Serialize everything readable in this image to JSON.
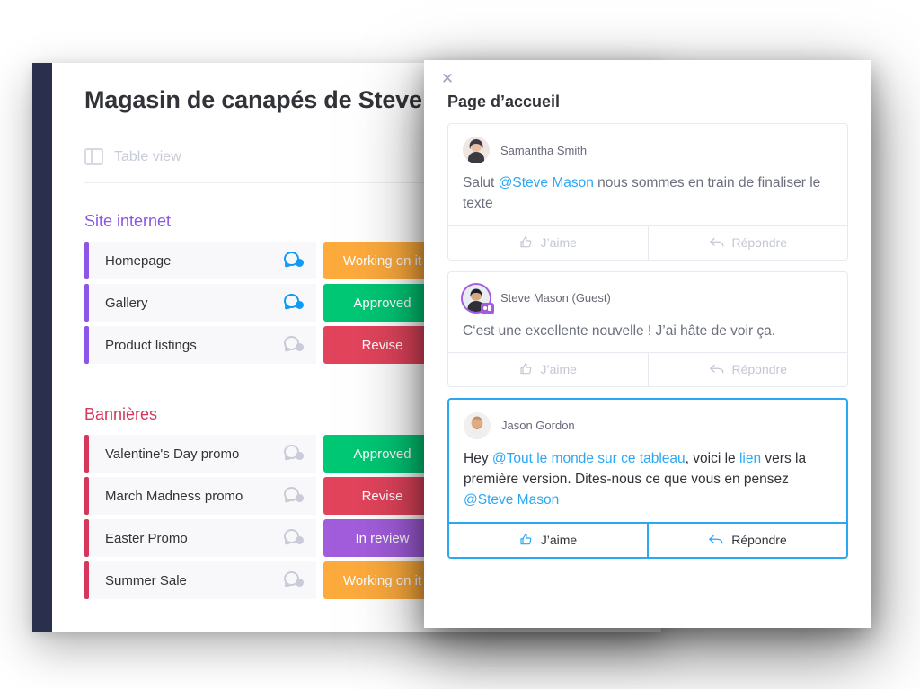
{
  "board": {
    "title": "Magasin de canapés de Steve",
    "view_label": "Table view",
    "view_icon": "table-view-icon",
    "groups": [
      {
        "name": "Site internet",
        "color": "#8c54e8",
        "items": [
          {
            "name": "Homepage",
            "status": "Working on it",
            "status_color": "#FDAB3D",
            "chat": "active"
          },
          {
            "name": "Gallery",
            "status": "Approved",
            "status_color": "#00C875",
            "chat": "active"
          },
          {
            "name": "Product listings",
            "status": "Revise",
            "status_color": "#E2445C",
            "chat": "muted"
          }
        ]
      },
      {
        "name": "Bannières",
        "color": "#d6355c",
        "items": [
          {
            "name": "Valentine's Day promo",
            "status": "Approved",
            "status_color": "#00C875",
            "chat": "muted"
          },
          {
            "name": "March Madness promo",
            "status": "Revise",
            "status_color": "#E2445C",
            "chat": "muted"
          },
          {
            "name": "Easter Promo",
            "status": "In review",
            "status_color": "#A25DDC",
            "chat": "muted"
          },
          {
            "name": "Summer Sale",
            "status": "Working on it",
            "status_color": "#FDAB3D",
            "chat": "muted"
          }
        ]
      }
    ]
  },
  "updates": {
    "close_icon": "close-icon",
    "title": "Page d’accueil",
    "like_label": "J’aime",
    "reply_label": "Répondre",
    "like_icon": "thumbs-up-icon",
    "reply_icon": "reply-arrow-icon",
    "comments": [
      {
        "author": "Samantha Smith",
        "guest": false,
        "highlight": false,
        "segments": [
          {
            "text": "Salut ",
            "mention": false
          },
          {
            "text": "@Steve Mason",
            "mention": true
          },
          {
            "text": " nous sommes en train de finaliser le texte",
            "mention": false
          }
        ]
      },
      {
        "author": "Steve Mason (Guest)",
        "guest": true,
        "highlight": false,
        "segments": [
          {
            "text": "C‘est une excellente nouvelle ! J’ai hâte de voir ça.",
            "mention": false
          }
        ]
      },
      {
        "author": "Jason Gordon",
        "guest": false,
        "highlight": true,
        "segments": [
          {
            "text": "Hey ",
            "mention": false
          },
          {
            "text": "@Tout le monde sur ce tableau",
            "mention": true
          },
          {
            "text": ", voici le ",
            "mention": false
          },
          {
            "text": "lien",
            "mention": true
          },
          {
            "text": " vers la première version. Dites-nous ce que vous en pensez ",
            "mention": false
          },
          {
            "text": "@Steve Mason",
            "mention": true
          }
        ]
      }
    ]
  },
  "colors": {
    "accent_blue": "#2BA8F4",
    "sidebar_navy": "#292f4c",
    "row_bg": "#f8f8fa"
  }
}
